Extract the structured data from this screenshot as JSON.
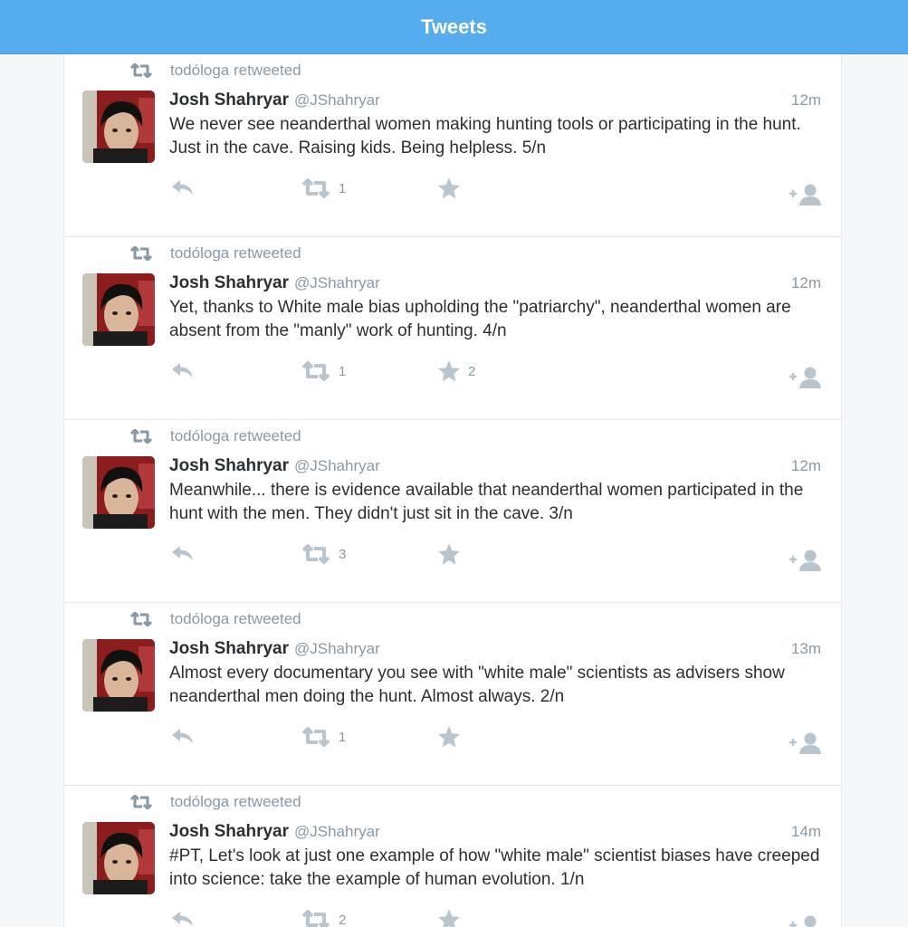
{
  "header": {
    "title": "Tweets"
  },
  "tweets": [
    {
      "context": "todóloga retweeted",
      "name": "Josh Shahryar",
      "handle": "@JShahryar",
      "time": "12m",
      "text": "We never see neanderthal women making hunting tools or participating in the hunt. Just in the cave. Raising kids. Being helpless. 5/n",
      "retweet_count": "1",
      "favorite_count": ""
    },
    {
      "context": "todóloga retweeted",
      "name": "Josh Shahryar",
      "handle": "@JShahryar",
      "time": "12m",
      "text": "Yet, thanks to White male bias upholding the \"patriarchy\", neanderthal women are absent from the \"manly\" work of hunting. 4/n",
      "retweet_count": "1",
      "favorite_count": "2"
    },
    {
      "context": "todóloga retweeted",
      "name": "Josh Shahryar",
      "handle": "@JShahryar",
      "time": "12m",
      "text": "Meanwhile... there is evidence available that neanderthal women participated in the hunt with the men. They didn't just sit in the cave. 3/n",
      "retweet_count": "3",
      "favorite_count": ""
    },
    {
      "context": "todóloga retweeted",
      "name": "Josh Shahryar",
      "handle": "@JShahryar",
      "time": "13m",
      "text": "Almost every documentary you see with \"white male\" scientists as advisers show neanderthal men doing the hunt. Almost always. 2/n",
      "retweet_count": "1",
      "favorite_count": ""
    },
    {
      "context": "todóloga retweeted",
      "name": "Josh Shahryar",
      "handle": "@JShahryar",
      "time": "14m",
      "text": "#PT, Let's look at just one example of how \"white male\" scientist biases have creeped into science: take the example of human evolution. 1/n",
      "retweet_count": "2",
      "favorite_count": ""
    }
  ],
  "icons": {
    "retweet_context": "retweet-icon",
    "reply": "reply-icon",
    "retweet": "retweet-icon",
    "favorite": "star-icon",
    "follow": "add-user-icon"
  },
  "colors": {
    "header_bg": "#55acee",
    "header_text": "#ffffff",
    "meta_text": "#8899a6",
    "icon_gray": "#b8c4ce",
    "body_text": "#292f33"
  }
}
